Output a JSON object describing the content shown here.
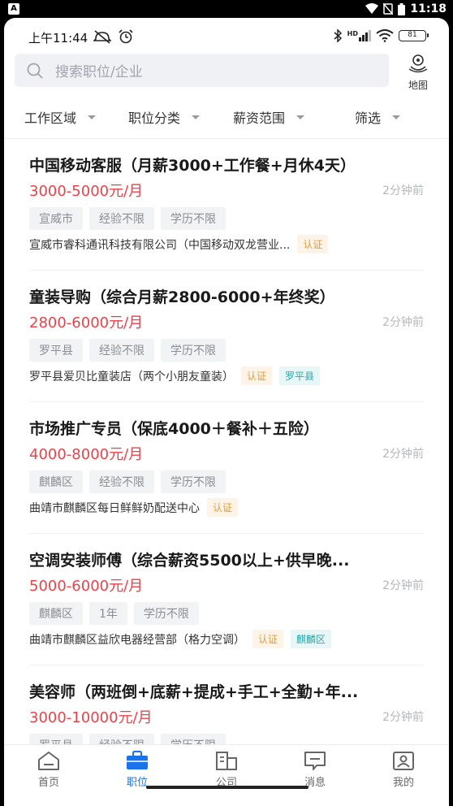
{
  "system": {
    "time": "11:18",
    "app_icon": "A"
  },
  "status": {
    "time": "上午11:44",
    "battery": "81",
    "network_label": "HD"
  },
  "search": {
    "placeholder": "搜索职位/企业"
  },
  "map": {
    "label": "地图"
  },
  "filters": [
    "工作区域",
    "职位分类",
    "薪资范围",
    "筛选"
  ],
  "jobs": [
    {
      "title": "中国移动客服（月薪3000+工作餐+月休4天）",
      "salary": "3000-5000元/月",
      "time": "2分钟前",
      "tags": [
        "宣威市",
        "经验不限",
        "学历不限"
      ],
      "company": "宣威市睿科通讯科技有限公司（中国移动双龙营业...",
      "badges": [
        "认证"
      ]
    },
    {
      "title": "童装导购（综合月薪2800-6000+年终奖）",
      "salary": "2800-6000元/月",
      "time": "2分钟前",
      "tags": [
        "罗平县",
        "经验不限",
        "学历不限"
      ],
      "company": "罗平县爱贝比童装店（两个小朋友童装）",
      "badges": [
        "认证",
        "罗平县"
      ]
    },
    {
      "title": "市场推广专员（保底4000＋餐补＋五险）",
      "salary": "4000-8000元/月",
      "time": "2分钟前",
      "tags": [
        "麒麟区",
        "经验不限",
        "学历不限"
      ],
      "company": "曲靖市麒麟区每日鲜鲜奶配送中心",
      "badges": [
        "认证"
      ]
    },
    {
      "title": "空调安装师傅（综合薪资5500以上+供早晚...",
      "salary": "5000-6000元/月",
      "time": "2分钟前",
      "tags": [
        "麒麟区",
        "1年",
        "学历不限"
      ],
      "company": "曲靖市麒麟区益欣电器经营部（格力空调）",
      "badges": [
        "认证",
        "麒麟区"
      ]
    },
    {
      "title": "美容师（两班倒+底薪+提成+手工+全勤+年...",
      "salary": "3000-10000元/月",
      "time": "2分钟前",
      "tags": [
        "罗平县",
        "经验不限",
        "学历不限"
      ],
      "company": "",
      "badges": []
    }
  ],
  "tabs": [
    {
      "label": "首页",
      "icon": "home-icon",
      "active": false
    },
    {
      "label": "职位",
      "icon": "briefcase-icon",
      "active": true
    },
    {
      "label": "公司",
      "icon": "building-icon",
      "active": false
    },
    {
      "label": "消息",
      "icon": "message-icon",
      "active": false
    },
    {
      "label": "我的",
      "icon": "profile-icon",
      "active": false
    }
  ],
  "colors": {
    "accent": "#1a73e8",
    "salary": "#e8434b",
    "auth_badge": "#e09b3d",
    "area_badge": "#2fa6a8"
  }
}
